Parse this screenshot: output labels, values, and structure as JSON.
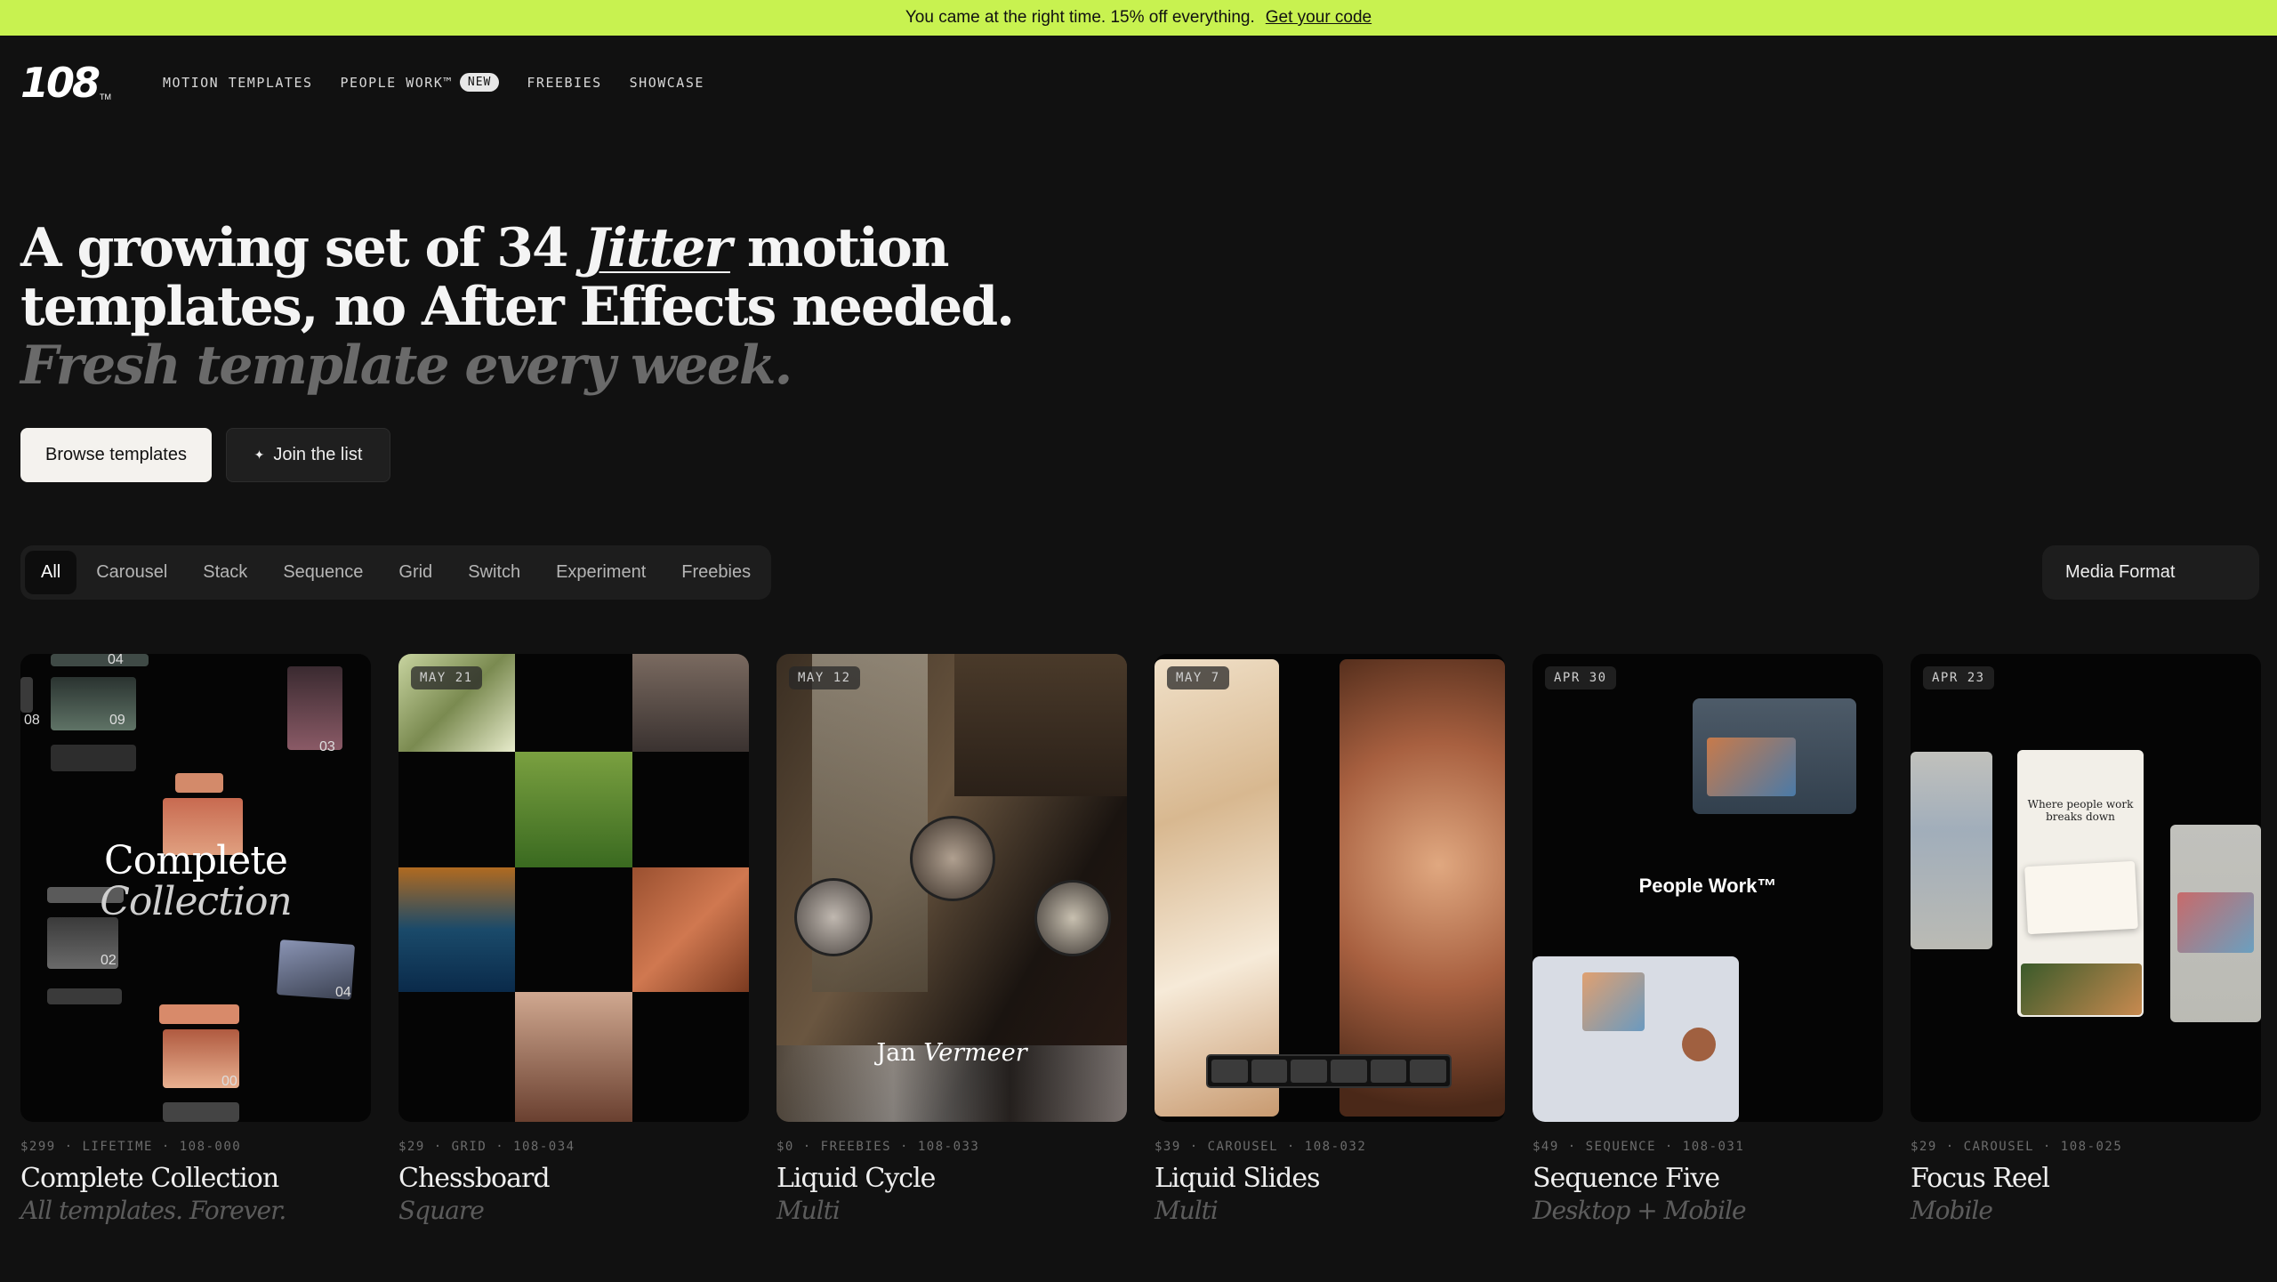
{
  "banner": {
    "text": "You came at the right time. 15% off everything.",
    "link": "Get your code"
  },
  "nav": {
    "logo": "108",
    "logo_tm": "TM",
    "links": [
      "MOTION TEMPLATES",
      "PEOPLE WORK™",
      "FREEBIES",
      "SHOWCASE"
    ],
    "new_badge": "NEW"
  },
  "hero": {
    "line1_pre": "A growing set of 34 ",
    "line1_jitter": "Jitter",
    "line1_post": " motion",
    "line2": "templates, no After Effects needed.",
    "subline": "Fresh template every week."
  },
  "cta": {
    "primary": "Browse templates",
    "secondary": "Join the list",
    "secondary_icon": "sparkle-icon"
  },
  "filters": [
    "All",
    "Carousel",
    "Stack",
    "Sequence",
    "Grid",
    "Switch",
    "Experiment",
    "Freebies"
  ],
  "active_filter": "All",
  "media_format": "Media Format",
  "colors": {
    "banner": "#c8f250",
    "background": "#111111"
  },
  "cards": [
    {
      "date": "",
      "meta": "$299 · LIFETIME · 108-000",
      "title": "Complete Collection",
      "subtitle": "All templates. Forever.",
      "overlay_title": "Complete",
      "overlay_sub": "Collection",
      "numbers": [
        "04",
        "03",
        "09",
        "08",
        "03",
        "02",
        "04",
        "00"
      ]
    },
    {
      "date": "MAY 21",
      "meta": "$29 · GRID · 108-034",
      "title": "Chessboard",
      "subtitle": "Square"
    },
    {
      "date": "MAY 12",
      "meta": "$0 · FREEBIES · 108-033",
      "title": "Liquid Cycle",
      "subtitle": "Multi",
      "overlay_first": "Jan ",
      "overlay_last": "Vermeer"
    },
    {
      "date": "MAY 7",
      "meta": "$39 · CAROUSEL · 108-032",
      "title": "Liquid Slides",
      "subtitle": "Multi"
    },
    {
      "date": "APR 30",
      "meta": "$49 · SEQUENCE · 108-031",
      "title": "Sequence Five",
      "subtitle": "Desktop + Mobile",
      "overlay": "People Work™"
    },
    {
      "date": "APR 23",
      "meta": "$29 · CAROUSEL · 108-025",
      "title": "Focus Reel",
      "subtitle": "Mobile",
      "overlay": "Where people work breaks down"
    }
  ]
}
